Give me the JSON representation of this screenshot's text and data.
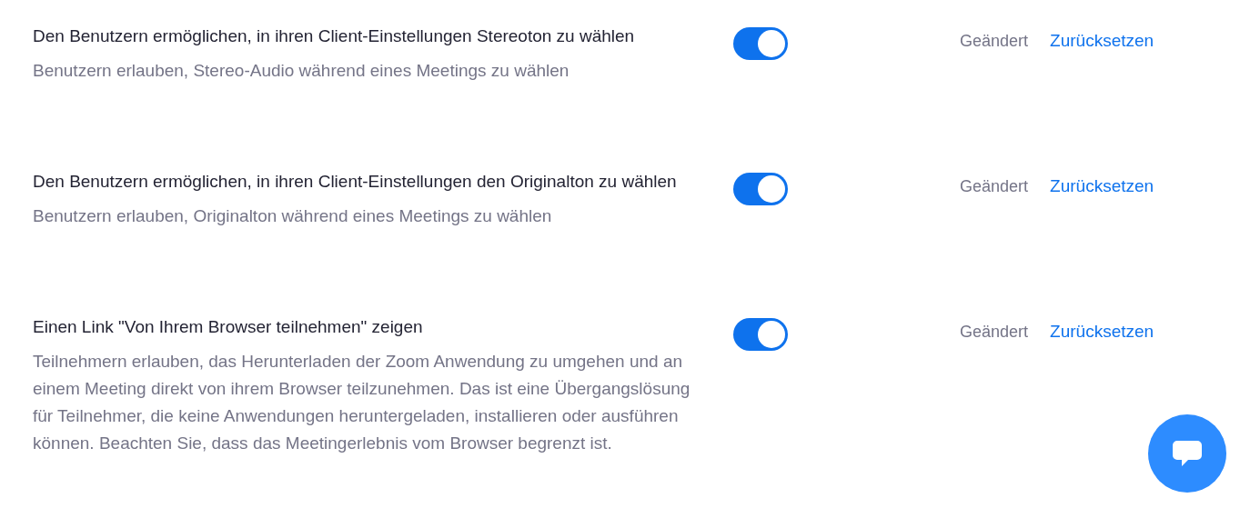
{
  "settings": [
    {
      "title": "Den Benutzern ermöglichen, in ihren Client-Einstellungen Stereoton zu wählen",
      "description": "Benutzern erlauben, Stereo-Audio während eines Meetings zu wählen",
      "on": true,
      "status": "Geändert",
      "reset_link": "Zurücksetzen"
    },
    {
      "title": "Den Benutzern ermöglichen, in ihren Client-Einstellungen den Originalton zu wählen",
      "description": "Benutzern erlauben, Originalton während eines Meetings zu wählen",
      "on": true,
      "status": "Geändert",
      "reset_link": "Zurücksetzen"
    },
    {
      "title": "Einen Link \"Von Ihrem Browser teilnehmen\" zeigen",
      "description": "Teilnehmern erlauben, das Herunterladen der Zoom Anwendung zu umgehen und an einem Meeting direkt von ihrem Browser teilzunehmen. Das ist eine Übergangslösung für Teilnehmer, die keine Anwendungen heruntergeladen, installieren oder ausführen können. Beachten Sie, dass das Meetingerlebnis vom Browser begrenzt ist.",
      "on": true,
      "status": "Geändert",
      "reset_link": "Zurücksetzen"
    }
  ]
}
